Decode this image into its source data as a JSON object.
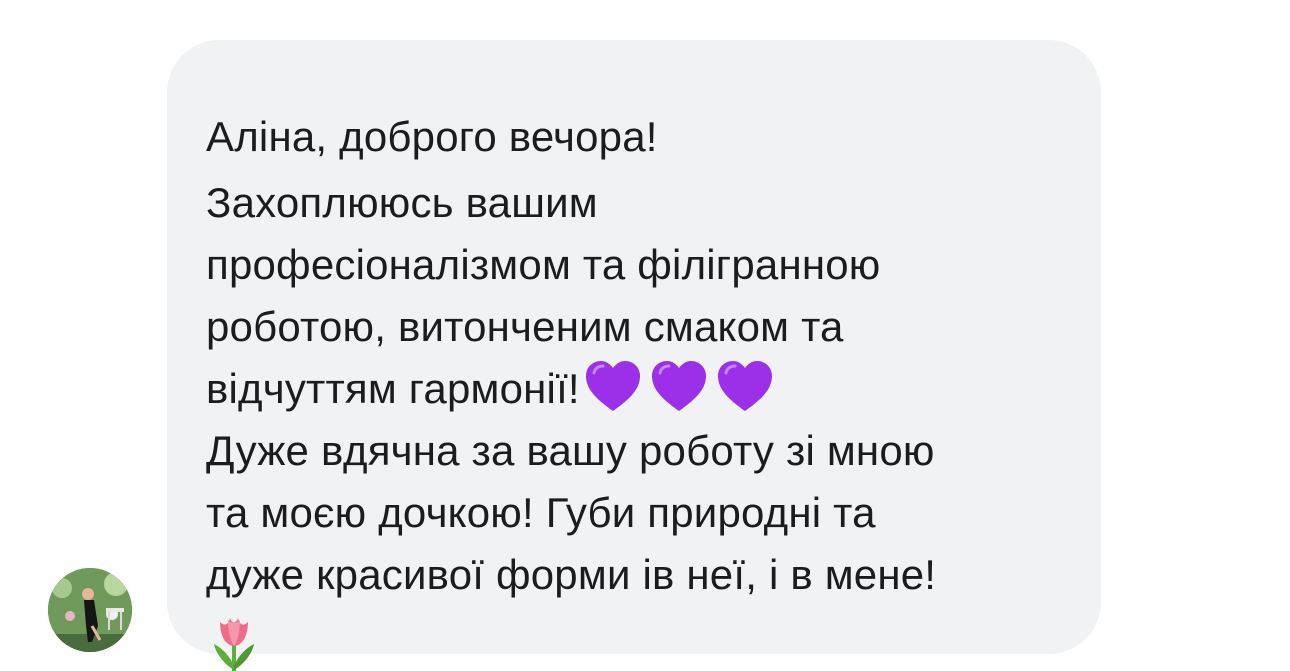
{
  "message": {
    "lines": [
      "Аліна, доброго вечора!",
      "Захоплююсь вашим",
      "професіоналізмом та філігранною",
      "роботою, витонченим смаком та",
      "відчуттям гармонії!",
      "Дуже вдячна за вашу роботу зі мною",
      "та моєю дочкою! Губи природні та",
      "дуже красивої форми ів неї, і в мене!"
    ],
    "emojis": [
      "purple-heart",
      "purple-heart",
      "purple-heart",
      "tulip"
    ]
  },
  "colors": {
    "bubble": "#f1f2f4",
    "text": "#1c1c1e",
    "heart": "#9b30e8",
    "tulip_petal": "#f06b8a",
    "tulip_leaf": "#5fae3c"
  },
  "sender": {
    "avatar": "user-avatar-photo"
  }
}
